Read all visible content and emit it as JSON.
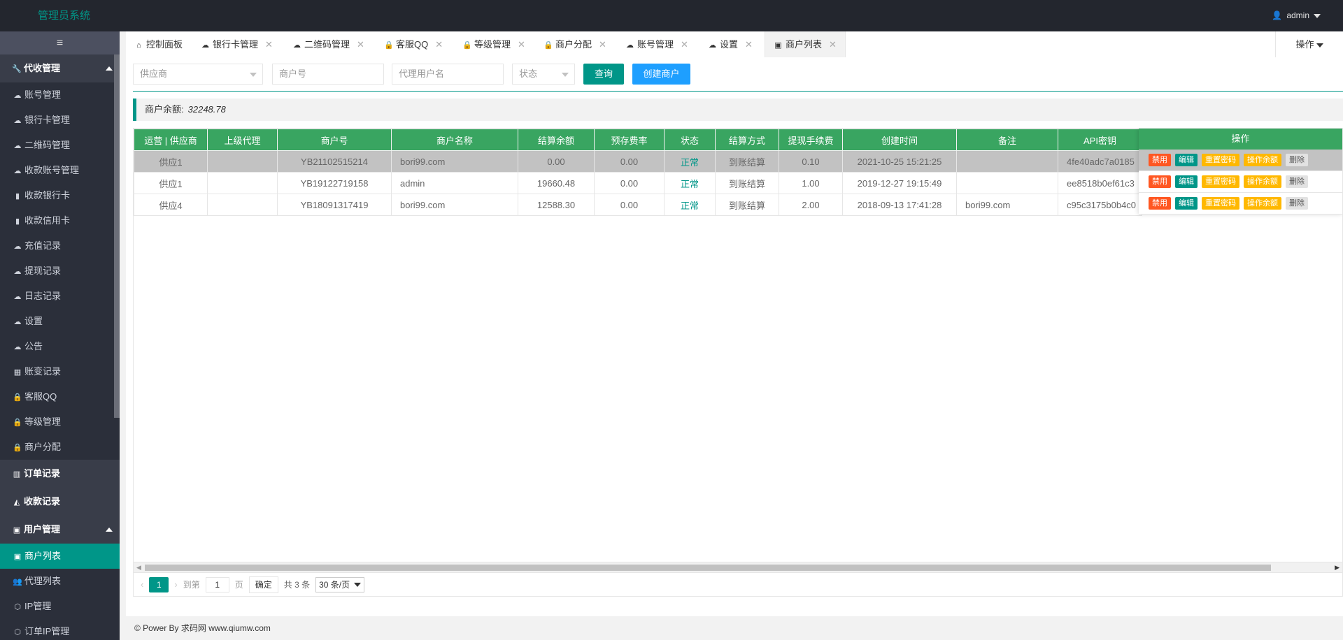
{
  "header": {
    "brand": "管理员系统",
    "user": "admin"
  },
  "sidebar": {
    "toggle": "≡",
    "groups": [
      {
        "label": "代收管理",
        "icon": "wrench-icon"
      },
      {
        "label": "用户管理",
        "icon": "user-card-icon"
      }
    ],
    "collect_items": [
      {
        "label": "账号管理"
      },
      {
        "label": "银行卡管理"
      },
      {
        "label": "二维码管理"
      },
      {
        "label": "收款账号管理"
      },
      {
        "label": "收款银行卡"
      },
      {
        "label": "收款信用卡"
      },
      {
        "label": "充值记录"
      },
      {
        "label": "提现记录"
      },
      {
        "label": "日志记录"
      },
      {
        "label": "设置"
      },
      {
        "label": "公告"
      },
      {
        "label": "账变记录"
      },
      {
        "label": "客服QQ"
      },
      {
        "label": "等级管理"
      },
      {
        "label": "商户分配"
      }
    ],
    "order_record": "订单记录",
    "payment_record": "收款记录",
    "user_items": [
      {
        "label": "商户列表"
      },
      {
        "label": "代理列表"
      },
      {
        "label": "IP管理"
      },
      {
        "label": "订单IP管理"
      }
    ]
  },
  "tabs": [
    {
      "label": "控制面板"
    },
    {
      "label": "银行卡管理"
    },
    {
      "label": "二维码管理"
    },
    {
      "label": "客服QQ"
    },
    {
      "label": "等级管理"
    },
    {
      "label": "商户分配"
    },
    {
      "label": "账号管理"
    },
    {
      "label": "设置"
    },
    {
      "label": "商户列表"
    }
  ],
  "tab_ops": "操作",
  "filters": {
    "supplier_placeholder": "供应商",
    "merchant_no_placeholder": "商户号",
    "agent_placeholder": "代理用户名",
    "status_placeholder": "状态",
    "query_btn": "查询",
    "create_btn": "创建商户"
  },
  "balance": {
    "label": "商户余额:",
    "value": "32248.78"
  },
  "table": {
    "headers": [
      "运营 | 供应商",
      "上级代理",
      "商户号",
      "商户名称",
      "结算余额",
      "预存费率",
      "状态",
      "结算方式",
      "提现手续费",
      "创建时间",
      "备注",
      "API密钥"
    ],
    "actions_header": "操作",
    "rows": [
      {
        "supplier": "供应1",
        "agent": "",
        "no": "YB21102515214",
        "name": "bori99.com",
        "balance": "0.00",
        "rate": "0.00",
        "status": "正常",
        "settle": "到账结算",
        "fee": "0.10",
        "created": "2021-10-25 15:21:25",
        "remark": "",
        "api": "4fe40adc7a0185"
      },
      {
        "supplier": "供应1",
        "agent": "",
        "no": "YB19122719158",
        "name": "admin",
        "balance": "19660.48",
        "rate": "0.00",
        "status": "正常",
        "settle": "到账结算",
        "fee": "1.00",
        "created": "2019-12-27 19:15:49",
        "remark": "",
        "api": "ee8518b0ef61c3"
      },
      {
        "supplier": "供应4",
        "agent": "",
        "no": "YB18091317419",
        "name": "bori99.com",
        "balance": "12588.30",
        "rate": "0.00",
        "status": "正常",
        "settle": "到账结算",
        "fee": "2.00",
        "created": "2018-09-13 17:41:28",
        "remark": "bori99.com",
        "api": "c95c3175b0b4c0"
      }
    ],
    "action_labels": {
      "disable": "禁用",
      "edit": "编辑",
      "reset_pwd": "重置密码",
      "op_balance": "操作余额",
      "delete": "删除"
    }
  },
  "pager": {
    "prev": "‹",
    "current": "1",
    "next": "›",
    "goto": "到第",
    "page_value": "1",
    "page_unit": "页",
    "confirm": "确定",
    "total": "共 3 条",
    "page_size": "30 条/页"
  },
  "footer": "© Power By 求码网 www.qiumw.com"
}
